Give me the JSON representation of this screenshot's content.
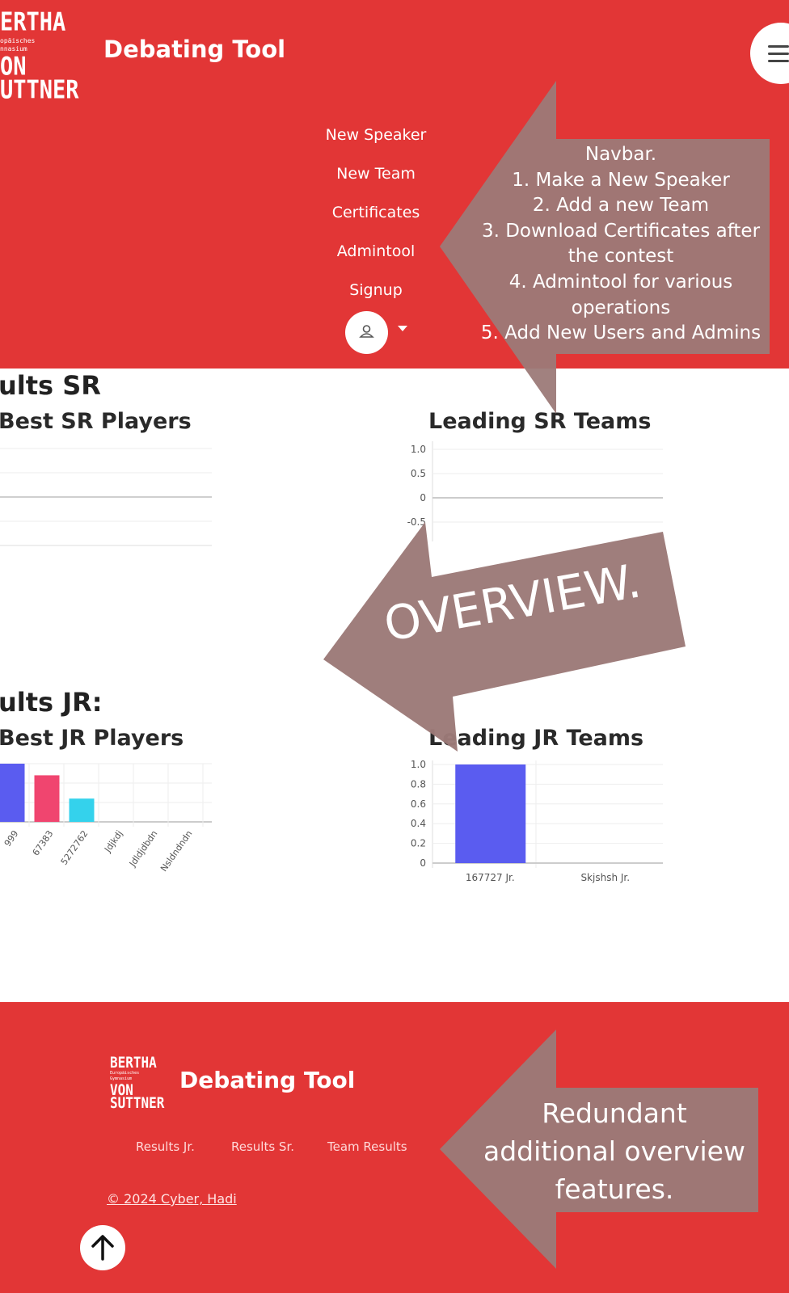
{
  "header": {
    "logo": {
      "line1": "ERTHA",
      "small1": "opäisches",
      "small2": "nnasium",
      "line2": "ON",
      "line3": "UTTNER"
    },
    "title": "Debating Tool",
    "menu_icon": "hamburger-menu-icon",
    "nav": [
      "New Speaker",
      "New Team",
      "Certificates",
      "Admintool",
      "Signup"
    ],
    "user_icon": "user-icon",
    "caret_icon": "caret-down-icon"
  },
  "callouts": {
    "navbar": [
      "Navbar.",
      "1. Make a New Speaker",
      "2. Add a new Team",
      "3. Download Certificates after",
      "the contest",
      "4. Admintool for various",
      "operations",
      "5. Add New Users and Admins"
    ],
    "overview": "OVERVIEW.",
    "redundant": [
      "Redundant",
      "additional overview",
      "features."
    ],
    "color": "#9c7a78"
  },
  "results_sr": {
    "heading": "ults SR",
    "players_title": "Best SR Players",
    "teams_title": "Leading SR Teams"
  },
  "results_jr": {
    "heading": "ults JR:",
    "players_title": "Best JR Players",
    "teams_title": "Leading JR Teams"
  },
  "chart_data": [
    {
      "type": "bar",
      "title": "Best SR Players",
      "categories": [],
      "values": [],
      "grid": true
    },
    {
      "type": "bar",
      "title": "Leading SR Teams",
      "categories": [],
      "values": [],
      "yticks": [
        "1.0",
        "0.5",
        "0",
        "-0.5"
      ],
      "ylim": [
        -0.5,
        1.0
      ],
      "grid": true
    },
    {
      "type": "bar",
      "title": "Best JR Players",
      "categories": [
        "999",
        "67383",
        "5272762",
        "Jdjkdj",
        "Jdldjdbdn",
        "Nsldndndn"
      ],
      "values": [
        1.0,
        0.8,
        0.4,
        0,
        0,
        0
      ],
      "colors": [
        "#5a5cf0",
        "#f0456f",
        "#34d2ec",
        "#cccccc",
        "#cccccc",
        "#cccccc"
      ],
      "grid": true
    },
    {
      "type": "bar",
      "title": "Leading JR Teams",
      "categories": [
        "167727 Jr.",
        "Skjshsh Jr."
      ],
      "values": [
        1.0,
        0
      ],
      "yticks": [
        "1.0",
        "0.8",
        "0.6",
        "0.4",
        "0.2",
        "0"
      ],
      "ylim": [
        0,
        1.0
      ],
      "bar_color": "#5a5cf0",
      "grid": true
    }
  ],
  "footer": {
    "logo": {
      "line1": "BERTHA",
      "small1": "Europäisches",
      "small2": "Gymnasium",
      "line2": "VON",
      "line3": "SUTTNER"
    },
    "title": "Debating Tool",
    "links": [
      "Results Jr.",
      "Results Sr.",
      "Team Results"
    ],
    "copyright": "© 2024  Cyber, Hadi",
    "scroll_top_icon": "arrow-up-icon"
  },
  "colors": {
    "brand_red": "#e23636",
    "callout": "#9c7a78",
    "bar_blue": "#5a5cf0"
  }
}
